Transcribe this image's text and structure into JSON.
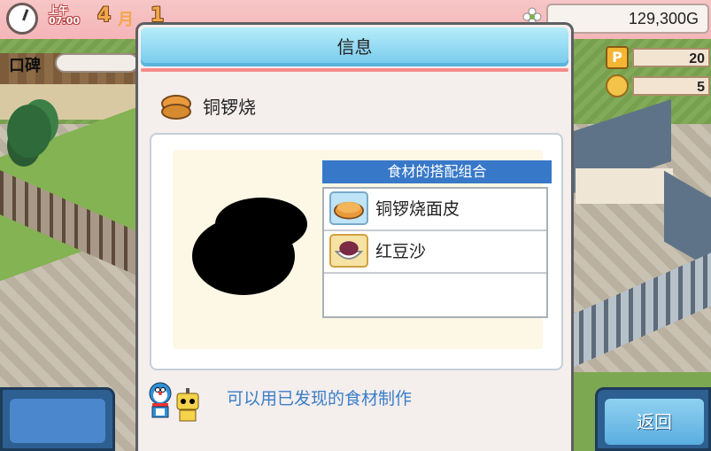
{
  "hud": {
    "ampm": "上午",
    "time": "07:00",
    "month": "4",
    "month_label": "月",
    "day": "1",
    "money": "129,300G",
    "reputation_label": "口碑",
    "stat_p": "20",
    "stat_medal": "5"
  },
  "dialog": {
    "title": "信息",
    "item_name": "铜锣烧",
    "combo_header": "食材的搭配组合",
    "ingredients": [
      {
        "name": "铜锣烧面皮",
        "icon": "pancake-icon"
      },
      {
        "name": "红豆沙",
        "icon": "red-bean-bowl-icon"
      },
      {
        "name": "",
        "icon": ""
      }
    ],
    "hint": "可以用已发现的食材制作"
  },
  "buttons": {
    "back": "返回"
  },
  "colors": {
    "header": "#75c9ec",
    "accent_line": "#f58c8c",
    "combo_header": "#3878c8",
    "hint": "#3a7ec8"
  }
}
